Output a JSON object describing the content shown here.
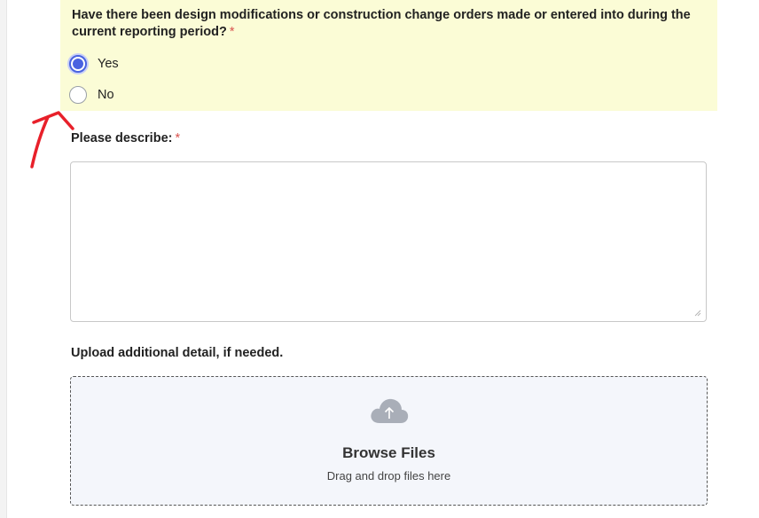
{
  "question": {
    "text": "Have there been design modifications or construction change orders made or entered into during the current reporting period?",
    "required_mark": "*",
    "options": [
      {
        "label": "Yes",
        "checked": true
      },
      {
        "label": "No",
        "checked": false
      }
    ],
    "background_color": "#fbfcd6",
    "accent_color": "#4a63e0"
  },
  "describe": {
    "label": "Please describe:",
    "required_mark": "*",
    "value": ""
  },
  "upload": {
    "label": "Upload additional detail, if needed.",
    "icon": "cloud-upload-icon",
    "title": "Browse Files",
    "subtitle": "Drag and drop files here"
  },
  "annotation": {
    "icon": "red-arrow-annotation",
    "color": "#e8202a"
  }
}
